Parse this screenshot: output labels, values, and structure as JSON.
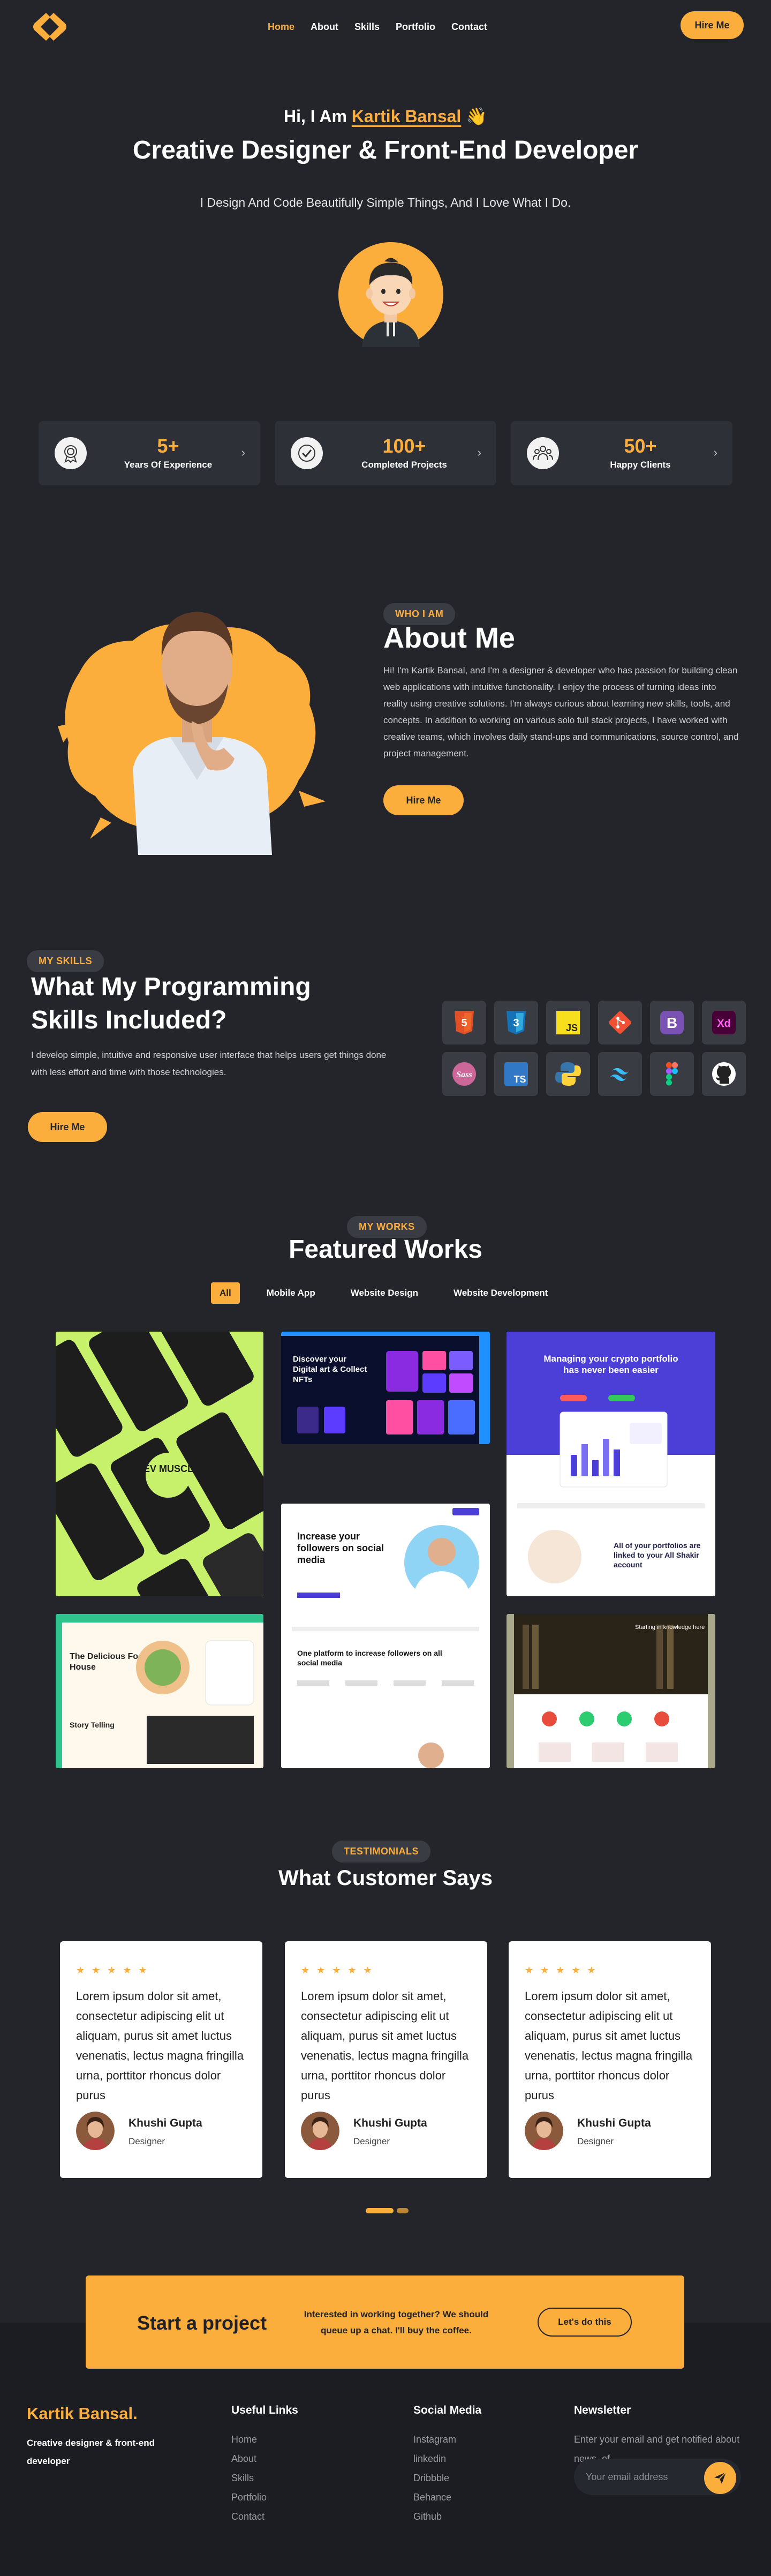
{
  "nav": {
    "links": [
      {
        "label": "Home",
        "active": true
      },
      {
        "label": "About",
        "active": false
      },
      {
        "label": "Skills",
        "active": false
      },
      {
        "label": "Portfolio",
        "active": false
      },
      {
        "label": "Contact",
        "active": false
      }
    ],
    "cta_label": "Hire Me"
  },
  "hero": {
    "greeting": "Hi, I Am ",
    "name": "Kartik Bansal",
    "wave": "👋",
    "title": "Creative Designer & Front-End Developer",
    "subtitle": "I Design And Code Beautifully Simple Things, And I Love What I Do."
  },
  "stats": [
    {
      "value": "5+",
      "label": "Years Of Experience",
      "icon": "medal-icon"
    },
    {
      "value": "100+",
      "label": "Completed Projects",
      "icon": "check-badge-icon"
    },
    {
      "value": "50+",
      "label": "Happy Clients",
      "icon": "people-group-icon"
    }
  ],
  "about": {
    "pill": "WHO I AM",
    "title": "About Me",
    "text": "Hi! I'm Kartik Bansal, and I'm a designer & developer who has passion for building clean web applications with intuitive functionality. I enjoy the process of turning ideas into reality using creative solutions. I'm always curious about learning new skills, tools, and concepts. In addition to working on various solo full stack projects, I have worked with creative teams, which involves daily stand-ups and communications, source control, and project management.",
    "cta_label": "Hire Me"
  },
  "skills": {
    "pill": "MY SKILLS",
    "title": "What My Programming Skills Included?",
    "text": "I develop simple, intuitive and responsive user interface that helps users get things done with less effort and time with those technologies.",
    "cta_label": "Hire Me",
    "icons": [
      "html5-icon",
      "css3-icon",
      "javascript-icon",
      "git-icon",
      "bootstrap-icon",
      "adobe-xd-icon",
      "sass-icon",
      "typescript-icon",
      "python-icon",
      "tailwind-icon",
      "figma-icon",
      "github-icon"
    ]
  },
  "works": {
    "pill": "MY WORKS",
    "title": "Featured Works",
    "filters": [
      {
        "label": "All",
        "active": true
      },
      {
        "label": "Mobile App",
        "active": false
      },
      {
        "label": "Website Design",
        "active": false
      },
      {
        "label": "Website Development",
        "active": false
      }
    ],
    "shot_texts": {
      "dev_badge": "DEV MUSCLE",
      "nft_title": "Discover your Digital art & Collect NFTs",
      "crypto_title": "Managing your crypto portfolio has never been easier",
      "crypto_sub": "All of your portfolios are linked to your All Shakir account",
      "social_title": "Increase your followers on social media",
      "social_sub": "One platform to increase followers on all social media",
      "food_title": "The Delicious Food House",
      "food_sub": "Story Telling",
      "library_title": "Starting in knowledge here"
    }
  },
  "testimonials": {
    "pill": "TESTIMONIALS",
    "title": "What Customer Says",
    "stars": "★ ★ ★ ★ ★",
    "items": [
      {
        "quote": "Lorem ipsum dolor sit amet, consectetur adipiscing elit ut aliquam, purus sit amet luctus venenatis, lectus magna fringilla urna, porttitor rhoncus dolor purus",
        "name": "Khushi Gupta",
        "role": "Designer"
      },
      {
        "quote": "Lorem ipsum dolor sit amet, consectetur adipiscing elit ut aliquam, purus sit amet luctus venenatis, lectus magna fringilla urna, porttitor rhoncus dolor purus",
        "name": "Khushi Gupta",
        "role": "Designer"
      },
      {
        "quote": "Lorem ipsum dolor sit amet, consectetur adipiscing elit ut aliquam, purus sit amet luctus venenatis, lectus magna fringilla urna, porttitor rhoncus dolor purus",
        "name": "Khushi Gupta",
        "role": "Designer"
      }
    ]
  },
  "cta": {
    "title": "Start a project",
    "text": "Interested in working together? We should queue up a chat. I'll buy the coffee.",
    "button": "Let's do this"
  },
  "footer": {
    "brand": "Kartik Bansal.",
    "tagline": "Creative designer & front-end developer",
    "useful_links": {
      "heading": "Useful Links",
      "items": [
        "Home",
        "About",
        "Skills",
        "Portfolio",
        "Contact"
      ]
    },
    "social": {
      "heading": "Social Media",
      "items": [
        "Instagram",
        "linkedin",
        "Dribbble",
        "Behance",
        "Github"
      ]
    },
    "newsletter": {
      "heading": "Newsletter",
      "text": "Enter your email and get notified about news, of.",
      "placeholder": "Your email address"
    }
  },
  "colors": {
    "accent": "#fbae3c",
    "background": "#23252b",
    "card": "#2e3037"
  }
}
